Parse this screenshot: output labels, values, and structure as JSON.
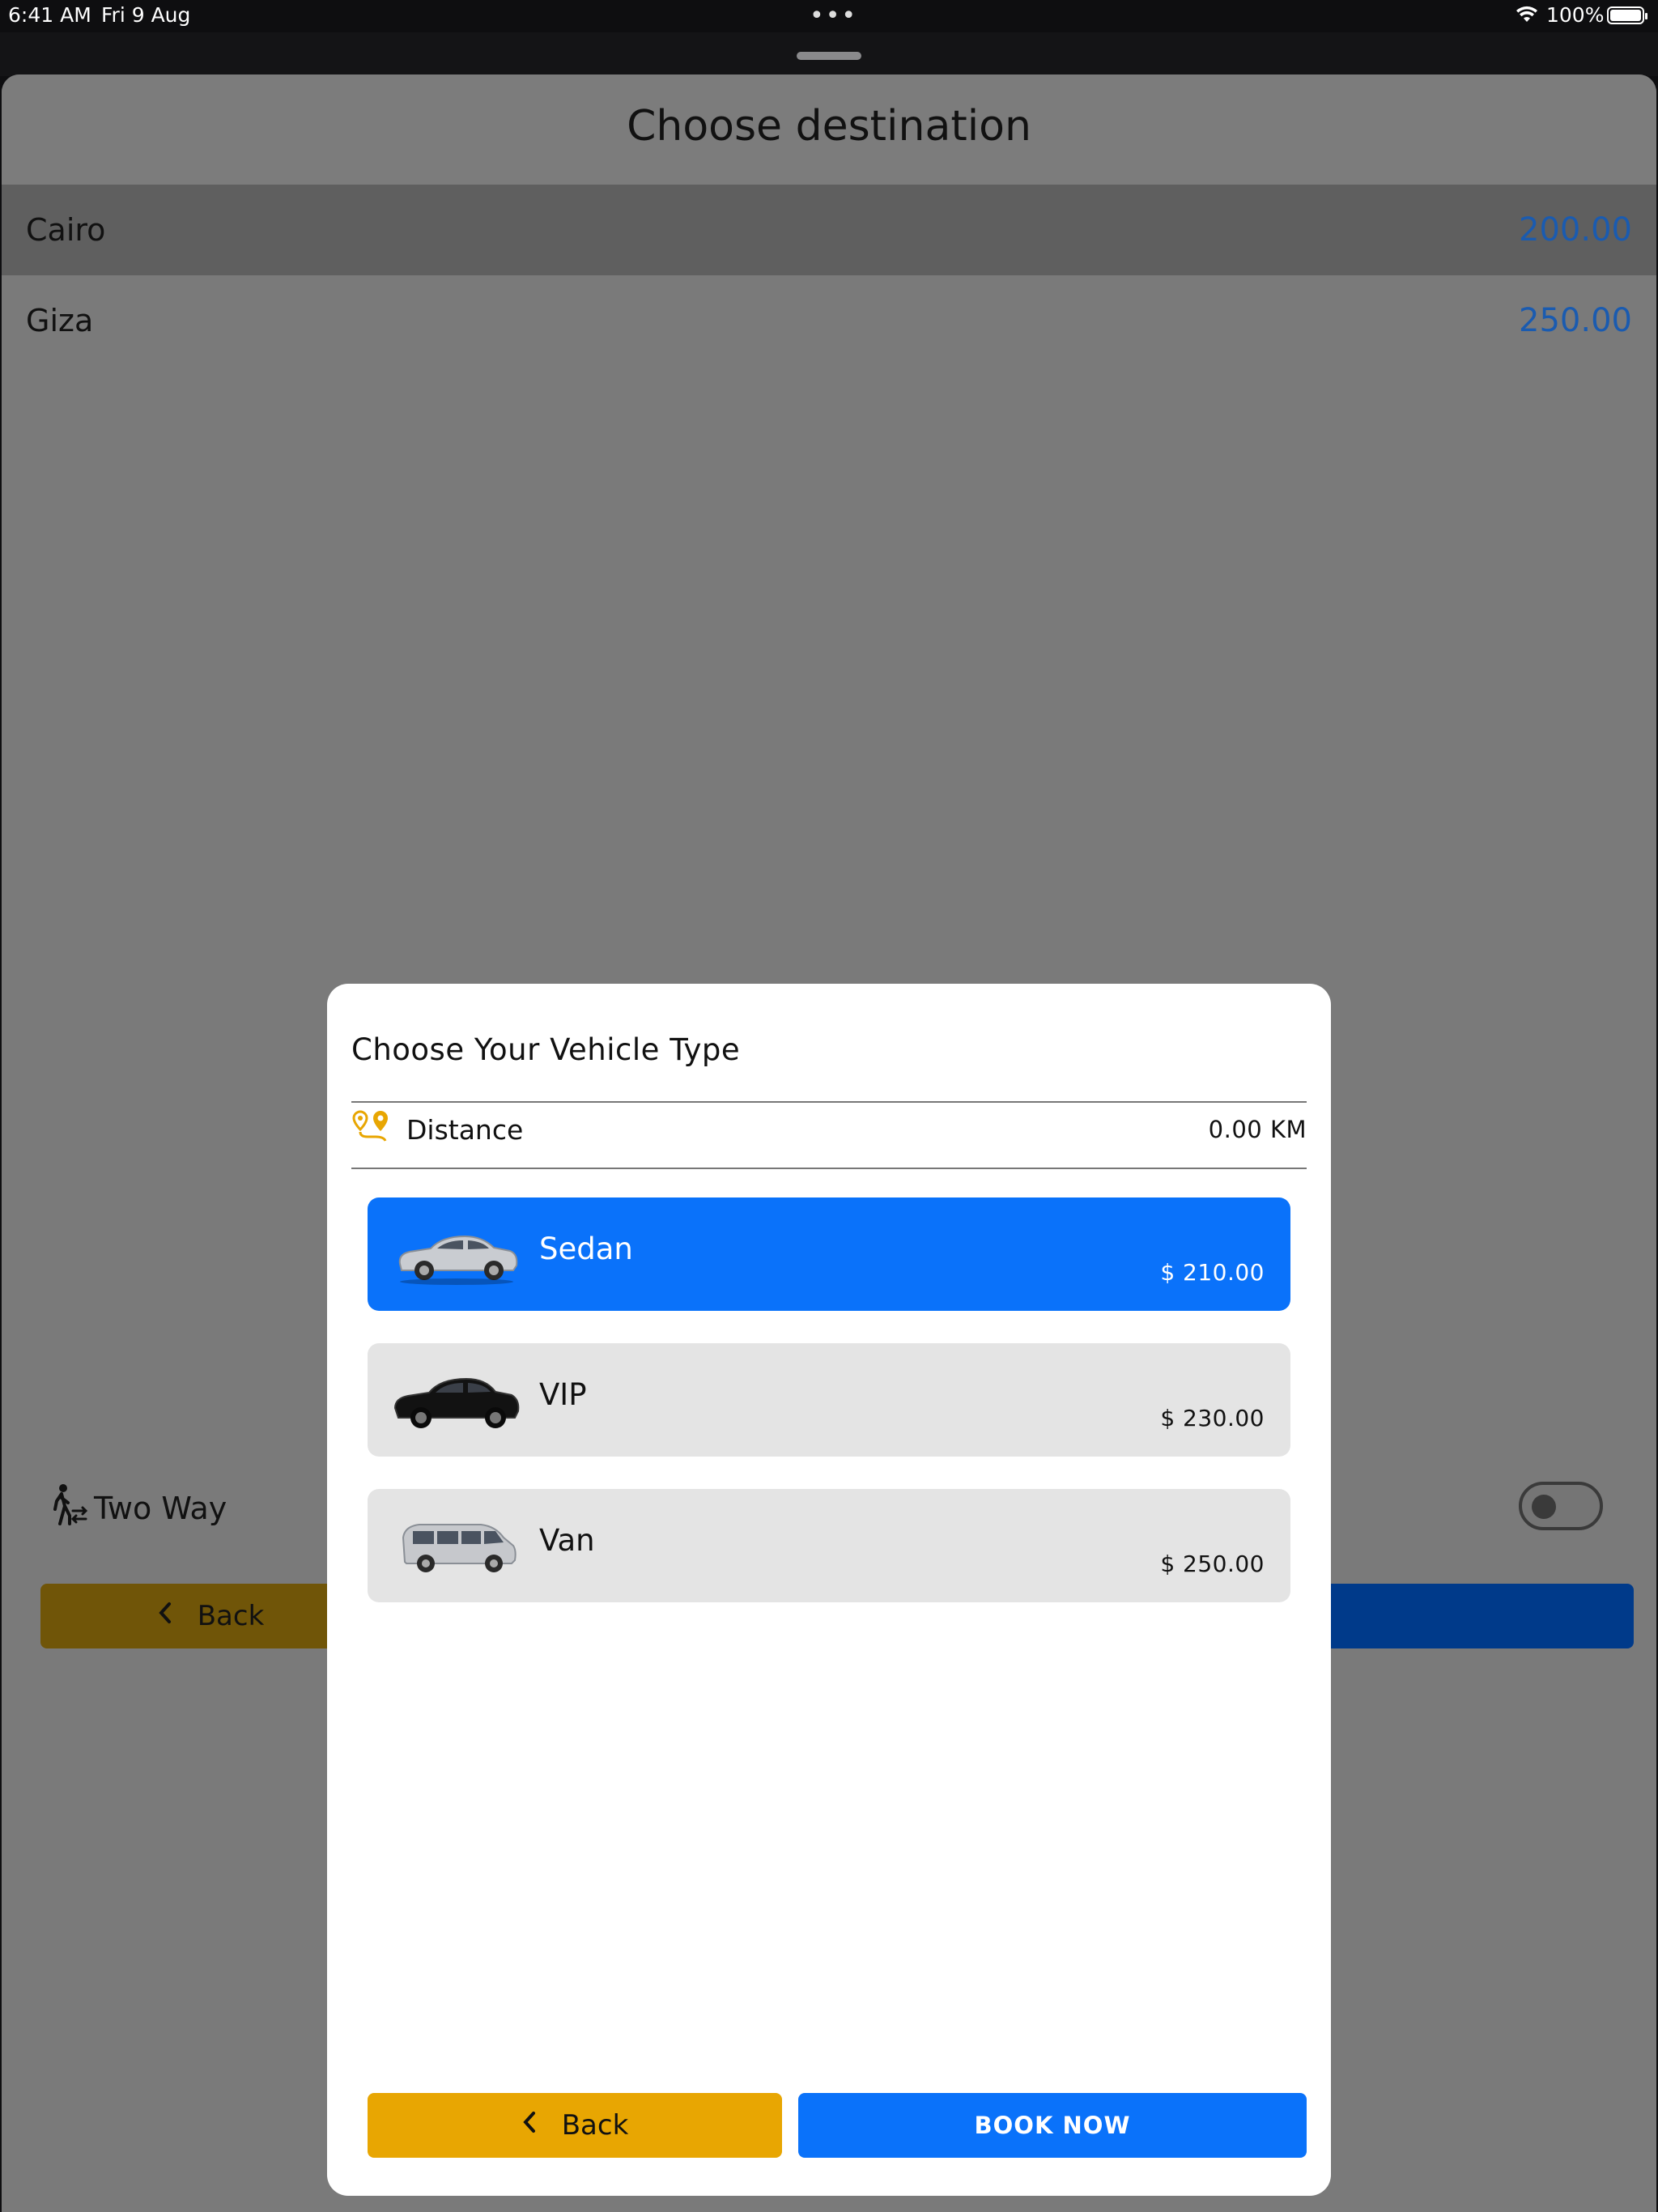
{
  "status_bar": {
    "time": "6:41 AM",
    "date": "Fri 9 Aug",
    "battery": "100%",
    "more_icon": "ellipsis-icon",
    "wifi_icon": "wifi-icon",
    "battery_icon": "battery-icon"
  },
  "sheet": {
    "title": "Choose destination",
    "destinations": [
      {
        "name": "Cairo",
        "price": "200.00",
        "selected": true
      },
      {
        "name": "Giza",
        "price": "250.00",
        "selected": false
      }
    ],
    "two_way_label": "Two Way",
    "two_way_icon": "walking-person-swap-icon",
    "two_way_on": false,
    "back_label": "Back"
  },
  "modal": {
    "title": "Choose Your Vehicle Type",
    "distance_label": "Distance",
    "distance_value": "0.00 KM",
    "distance_icon": "route-pin-icon",
    "vehicles": [
      {
        "name": "Sedan",
        "price": "$ 210.00",
        "selected": true,
        "image": "silver-sedan-car"
      },
      {
        "name": "VIP",
        "price": "$ 230.00",
        "selected": false,
        "image": "black-luxury-car"
      },
      {
        "name": "Van",
        "price": "$ 250.00",
        "selected": false,
        "image": "silver-van"
      }
    ],
    "back_label": "Back",
    "book_label": "BOOK NOW"
  },
  "colors": {
    "accent_blue": "#0a72fa",
    "accent_yellow": "#e8a602",
    "price_blue": "#1a5bb0",
    "overlay": "#7a7a7a"
  }
}
